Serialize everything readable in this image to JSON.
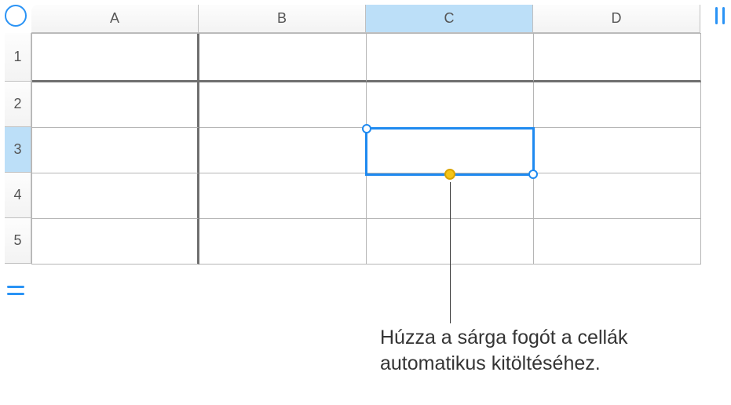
{
  "columns": [
    "A",
    "B",
    "C",
    "D"
  ],
  "rows": [
    "1",
    "2",
    "3",
    "4",
    "5"
  ],
  "selected_cell": {
    "col": "C",
    "row": "3"
  },
  "callout": "Húzza a sárga fogót a cellák automatikus kitöltéséhez.",
  "col_widths": {
    "A": 213,
    "B": 213,
    "C": 213,
    "D": 213
  },
  "row_heights": {
    "1": 62,
    "other": 58
  }
}
